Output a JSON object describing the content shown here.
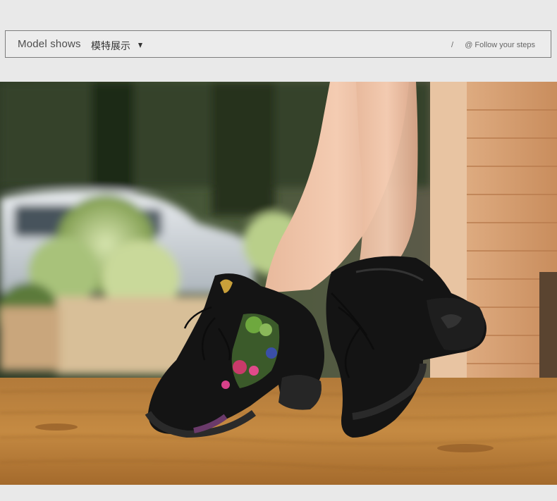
{
  "header": {
    "title_en": "Model shows",
    "title_cn": "模特展示",
    "dropdown_icon": "caret-down-icon",
    "divider": "/",
    "tagline": "@ Follow your steps"
  },
  "photo": {
    "subject": "model-wearing-dance-sneakers",
    "colors": {
      "shoe": "#141414",
      "floor": "#c8893a",
      "wall": "#d9a577",
      "foliage": "#a9c27a"
    }
  }
}
